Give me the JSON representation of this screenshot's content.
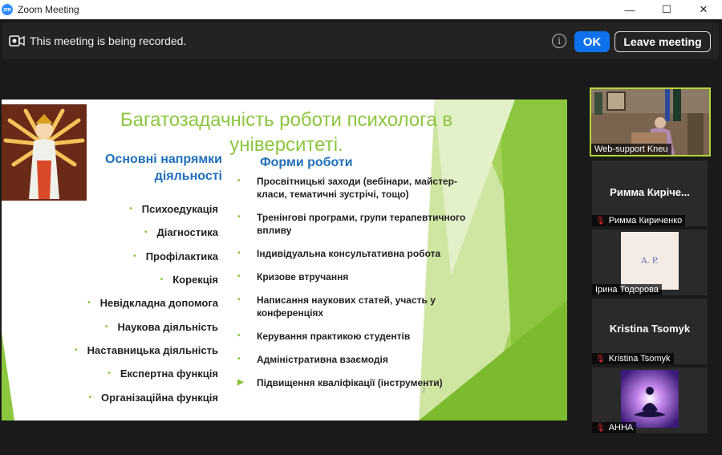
{
  "window": {
    "app_logo": "zm",
    "title": "Zoom Meeting",
    "minimize": "—",
    "maximize": "☐",
    "close": "✕"
  },
  "recording": {
    "message": "This meeting is being recorded.",
    "info": "i",
    "ok_label": "OK",
    "leave_label": "Leave meeting"
  },
  "slide": {
    "title": "Багатозадачність роботи психолога в університеті.",
    "left_heading": "Основні напрямки діяльності",
    "right_heading": "Форми роботи",
    "left_items": [
      "Психоедукація",
      "Діагностика",
      "Профілактика",
      "Корекція",
      "Невідкладна допомога",
      "Наукова діяльність",
      "Наставницька діяльність",
      "Експертна функція",
      "Організаційна функція"
    ],
    "right_items": [
      "Просвітницькі заходи (вебінари, майстер-класи, тематичні зустрічі, тощо)",
      "Тренінгові програми, групи терапевтичного впливу",
      "Індивідуальна консультативна робота",
      "Кризове втручання",
      "Написання наукових статей, участь у конференціях",
      "Керування практикою студентів",
      "Адміністративна взаємодія",
      "Підвищення кваліфікації (інструменти)"
    ],
    "page_number": "2",
    "bullet": "•",
    "arrow_bullet": "▶"
  },
  "participants": [
    {
      "label": "Web-support Kneu"
    },
    {
      "name": "Римма  Киріче...",
      "label": "Римма Кириченко",
      "muted": true
    },
    {
      "label": "Ірина Тодорова",
      "avatar_text": "A. P."
    },
    {
      "name": "Kristina Tsomyk",
      "label": "Kristina Tsomyk",
      "muted": true
    },
    {
      "label": "АННА",
      "muted": true
    }
  ],
  "icons": {
    "mute": "mic-muted-icon",
    "record": "record-icon"
  },
  "colors": {
    "accent_green": "#8cc63f",
    "heading_blue": "#1f6fb8",
    "zoom_blue": "#0e72ed",
    "active_speaker": "#b6d43a"
  }
}
